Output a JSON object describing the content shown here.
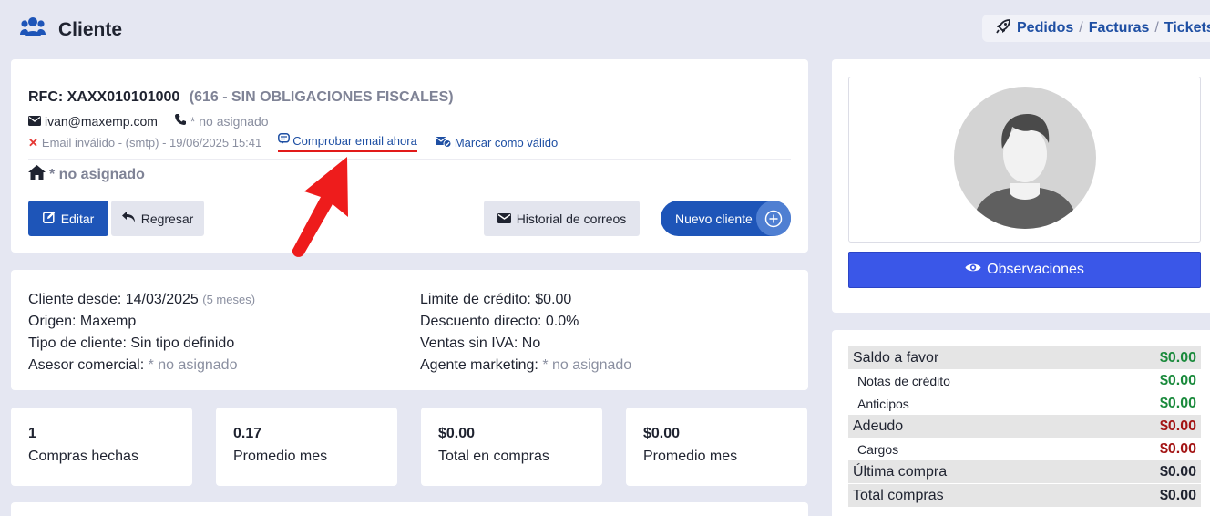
{
  "header": {
    "title": "Cliente",
    "links": {
      "pedidos": "Pedidos",
      "facturas": "Facturas",
      "tickets": "Tickets",
      "sep": "/"
    }
  },
  "client": {
    "rfc": "RFC: XAXX010101000",
    "regimen": "(616 - SIN OBLIGACIONES FISCALES)",
    "email": "ivan@maxemp.com",
    "phone": "* no asignado",
    "email_status": "Email inválido - (smtp) - 19/06/2025 15:41",
    "check_email_label": "Comprobar email ahora",
    "mark_valid_label": "Marcar como válido",
    "address": "* no asignado"
  },
  "actions": {
    "edit": "Editar",
    "back": "Regresar",
    "history": "Historial de correos",
    "new_client": "Nuevo cliente"
  },
  "info": {
    "since_label": "Cliente desde: 14/03/2025",
    "since_ago": "(5 meses)",
    "origin": "Origen: Maxemp",
    "type": "Tipo de cliente: Sin tipo definido",
    "advisor_label": "Asesor comercial:",
    "advisor_value": "* no asignado",
    "credit_limit": "Limite de crédito: $0.00",
    "discount": "Descuento directo: 0.0%",
    "no_vat": "Ventas sin IVA: No",
    "marketing_label": "Agente marketing:",
    "marketing_value": "* no asignado"
  },
  "stats": [
    {
      "value": "1",
      "label": "Compras hechas"
    },
    {
      "value": "0.17",
      "label": "Promedio mes"
    },
    {
      "value": "$0.00",
      "label": "Total en compras"
    },
    {
      "value": "$0.00",
      "label": "Promedio mes"
    }
  ],
  "profile": {
    "observations": "Observaciones"
  },
  "balance": {
    "saldo_favor": {
      "label": "Saldo a favor",
      "value": "$0.00"
    },
    "notas_credito": {
      "label": "Notas de crédito",
      "value": "$0.00"
    },
    "anticipos": {
      "label": "Anticipos",
      "value": "$0.00"
    },
    "adeudo": {
      "label": "Adeudo",
      "value": "$0.00"
    },
    "cargos": {
      "label": "Cargos",
      "value": "$0.00"
    },
    "ultima_compra": {
      "label": "Última compra",
      "value": "$0.00"
    },
    "total_compras": {
      "label": "Total compras",
      "value": "$0.00"
    }
  },
  "colors": {
    "primary": "#1e55b8",
    "observations": "#3a57e8",
    "positive": "#1a8a3c",
    "negative": "#a31414",
    "annotation": "#e21a1a"
  },
  "icons": [
    "users-icon",
    "rocket-icon",
    "envelope-icon",
    "phone-icon",
    "x-icon",
    "chat-icon",
    "envelope-check-icon",
    "home-icon",
    "edit-icon",
    "undo-icon",
    "plus-circle-icon",
    "eye-icon",
    "avatar-placeholder"
  ]
}
